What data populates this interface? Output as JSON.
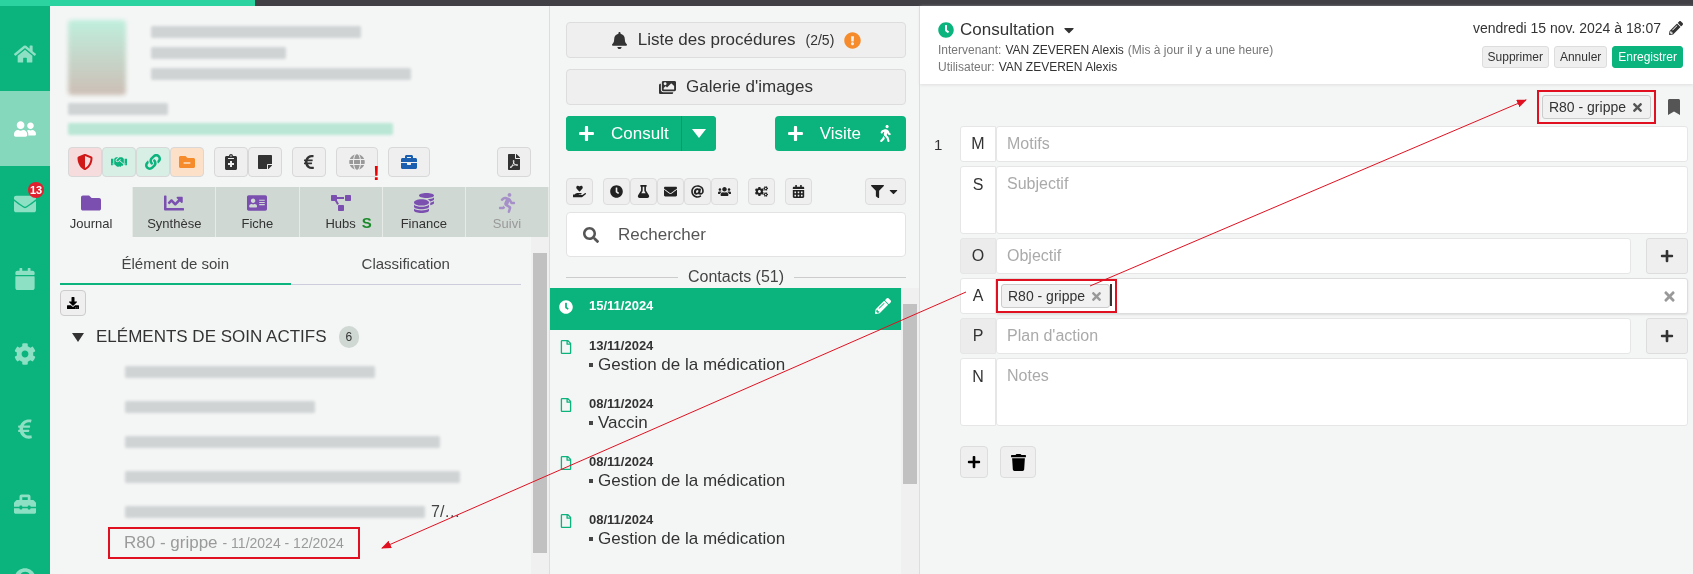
{
  "nav_rail": {
    "items": [
      {
        "selected": false
      },
      {
        "selected": true
      },
      {
        "selected": false,
        "badge": "13"
      },
      {
        "selected": false
      },
      {
        "selected": false
      },
      {
        "selected": false
      },
      {
        "selected": false
      },
      {
        "selected": false
      }
    ]
  },
  "patient": {
    "alert_mark": "!"
  },
  "tabs": [
    {
      "label": "Journal",
      "selected": true,
      "disabled": false
    },
    {
      "label": "Synthèse",
      "selected": false,
      "disabled": false
    },
    {
      "label": "Fiche",
      "selected": false,
      "disabled": false
    },
    {
      "label": "Hubs",
      "selected": false,
      "disabled": false,
      "badge": "S"
    },
    {
      "label": "Finance",
      "selected": false,
      "disabled": false
    },
    {
      "label": "Suivi",
      "selected": false,
      "disabled": true
    }
  ],
  "subtabs": [
    {
      "label": "Élément de soin",
      "selected": true
    },
    {
      "label": "Classification",
      "selected": false
    }
  ],
  "care_elements": {
    "title": "ELÉMENTS DE SOIN ACTIFS",
    "count": "6",
    "expanded": true,
    "items": [
      {
        "kind": "redacted"
      },
      {
        "kind": "redacted"
      },
      {
        "kind": "redacted"
      },
      {
        "kind": "redacted"
      },
      {
        "kind": "redacted",
        "suffix": "7/…"
      },
      {
        "kind": "entry",
        "label": "R80 - grippe",
        "dates": "- 11/2024 - 12/2024",
        "annotated": true
      }
    ]
  },
  "middle": {
    "procedures": {
      "label": "Liste des procédures",
      "count": "(2/5)"
    },
    "gallery": {
      "label": "Galerie d'images"
    },
    "consult": {
      "label": "Consult"
    },
    "visit": {
      "label": "Visite"
    },
    "search": {
      "placeholder": "Rechercher"
    },
    "contacts_header": "Contacts (51)",
    "contacts": [
      {
        "kind": "consultation",
        "date": "15/11/2024",
        "selected": true
      },
      {
        "kind": "document",
        "date": "13/11/2024",
        "title": "Gestion de la médication",
        "selected": false
      },
      {
        "kind": "document",
        "date": "08/11/2024",
        "title": "Vaccin",
        "selected": false
      },
      {
        "kind": "document",
        "date": "08/11/2024",
        "title": "Gestion de la médication",
        "selected": false
      },
      {
        "kind": "document",
        "date": "08/11/2024",
        "title": "Gestion de la médication",
        "selected": false
      }
    ]
  },
  "consultation": {
    "title": "Consultation",
    "intervenant_label": "Intervenant:",
    "intervenant": "VAN ZEVEREN Alexis",
    "updated": "(Mis à jour il y a une heure)",
    "user_label": "Utilisateur:",
    "user": "VAN ZEVEREN Alexis",
    "date": "vendredi 15 nov. 2024 à 18:07",
    "buttons": [
      {
        "label": "Supprimer",
        "kind": "default"
      },
      {
        "label": "Annuler",
        "kind": "default"
      },
      {
        "label": "Enregistrer",
        "kind": "primary"
      }
    ],
    "top_tag": {
      "label": "R80 - grippe",
      "annotated": true
    },
    "section_number": "1",
    "rows": [
      {
        "letter": "M",
        "kind": "text",
        "placeholder": "Motifs"
      },
      {
        "letter": "S",
        "kind": "textarea",
        "placeholder": "Subjectif"
      },
      {
        "letter": "O",
        "kind": "add",
        "placeholder": "Objectif"
      },
      {
        "letter": "A",
        "kind": "tags",
        "tags": [
          {
            "label": "R80 - grippe",
            "annotated": true
          }
        ]
      },
      {
        "letter": "P",
        "kind": "add",
        "placeholder": "Plan d'action"
      },
      {
        "letter": "N",
        "kind": "textarea",
        "placeholder": "Notes"
      }
    ]
  }
}
